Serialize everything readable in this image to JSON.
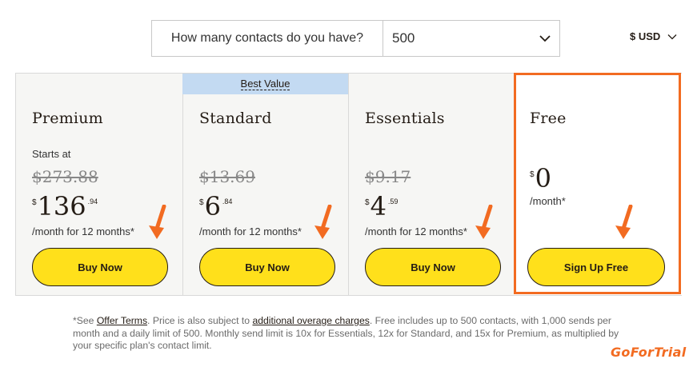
{
  "contacts": {
    "label": "How many contacts do you have?",
    "selected": "500",
    "chevron_icon": "chevron-down-icon"
  },
  "currency": {
    "label": "$ USD",
    "chevron_icon": "chevron-down-icon"
  },
  "best_value_label": "Best Value",
  "plans": [
    {
      "name": "Premium",
      "starts_at": "Starts at",
      "old_price": "$273.88",
      "currency_symbol": "$",
      "price_whole": "136",
      "price_cents": ".94",
      "period": "/month for 12 months*",
      "button": "Buy Now"
    },
    {
      "name": "Standard",
      "old_price": "$13.69",
      "currency_symbol": "$",
      "price_whole": "6",
      "price_cents": ".84",
      "period": "/month for 12 months*",
      "button": "Buy Now"
    },
    {
      "name": "Essentials",
      "old_price": "$9.17",
      "currency_symbol": "$",
      "price_whole": "4",
      "price_cents": ".59",
      "period": "/month for 12 months*",
      "button": "Buy Now"
    },
    {
      "name": "Free",
      "currency_symbol": "$",
      "price_whole": "0",
      "period": "/month*",
      "button": "Sign Up Free"
    }
  ],
  "annotations": {
    "arrow_icon": "orange-arrow-icon",
    "highlight_color": "#f26b21"
  },
  "colors": {
    "button_yellow": "#ffe01b",
    "best_value_blue": "#c3daf2",
    "card_bg": "#f6f6f4"
  },
  "footnote": {
    "part1": "*See ",
    "offer_terms": "Offer Terms",
    "part2": ". Price is also subject to ",
    "overage_link": "additional overage charges",
    "part3": ". Free includes up to 500 contacts, with 1,000 sends per month and a daily limit of 500. Monthly send limit is 10x for Essentials, 12x for Standard, and 15x for Premium, as multiplied by your specific plan's contact limit."
  },
  "watermark": "GoForTrial"
}
